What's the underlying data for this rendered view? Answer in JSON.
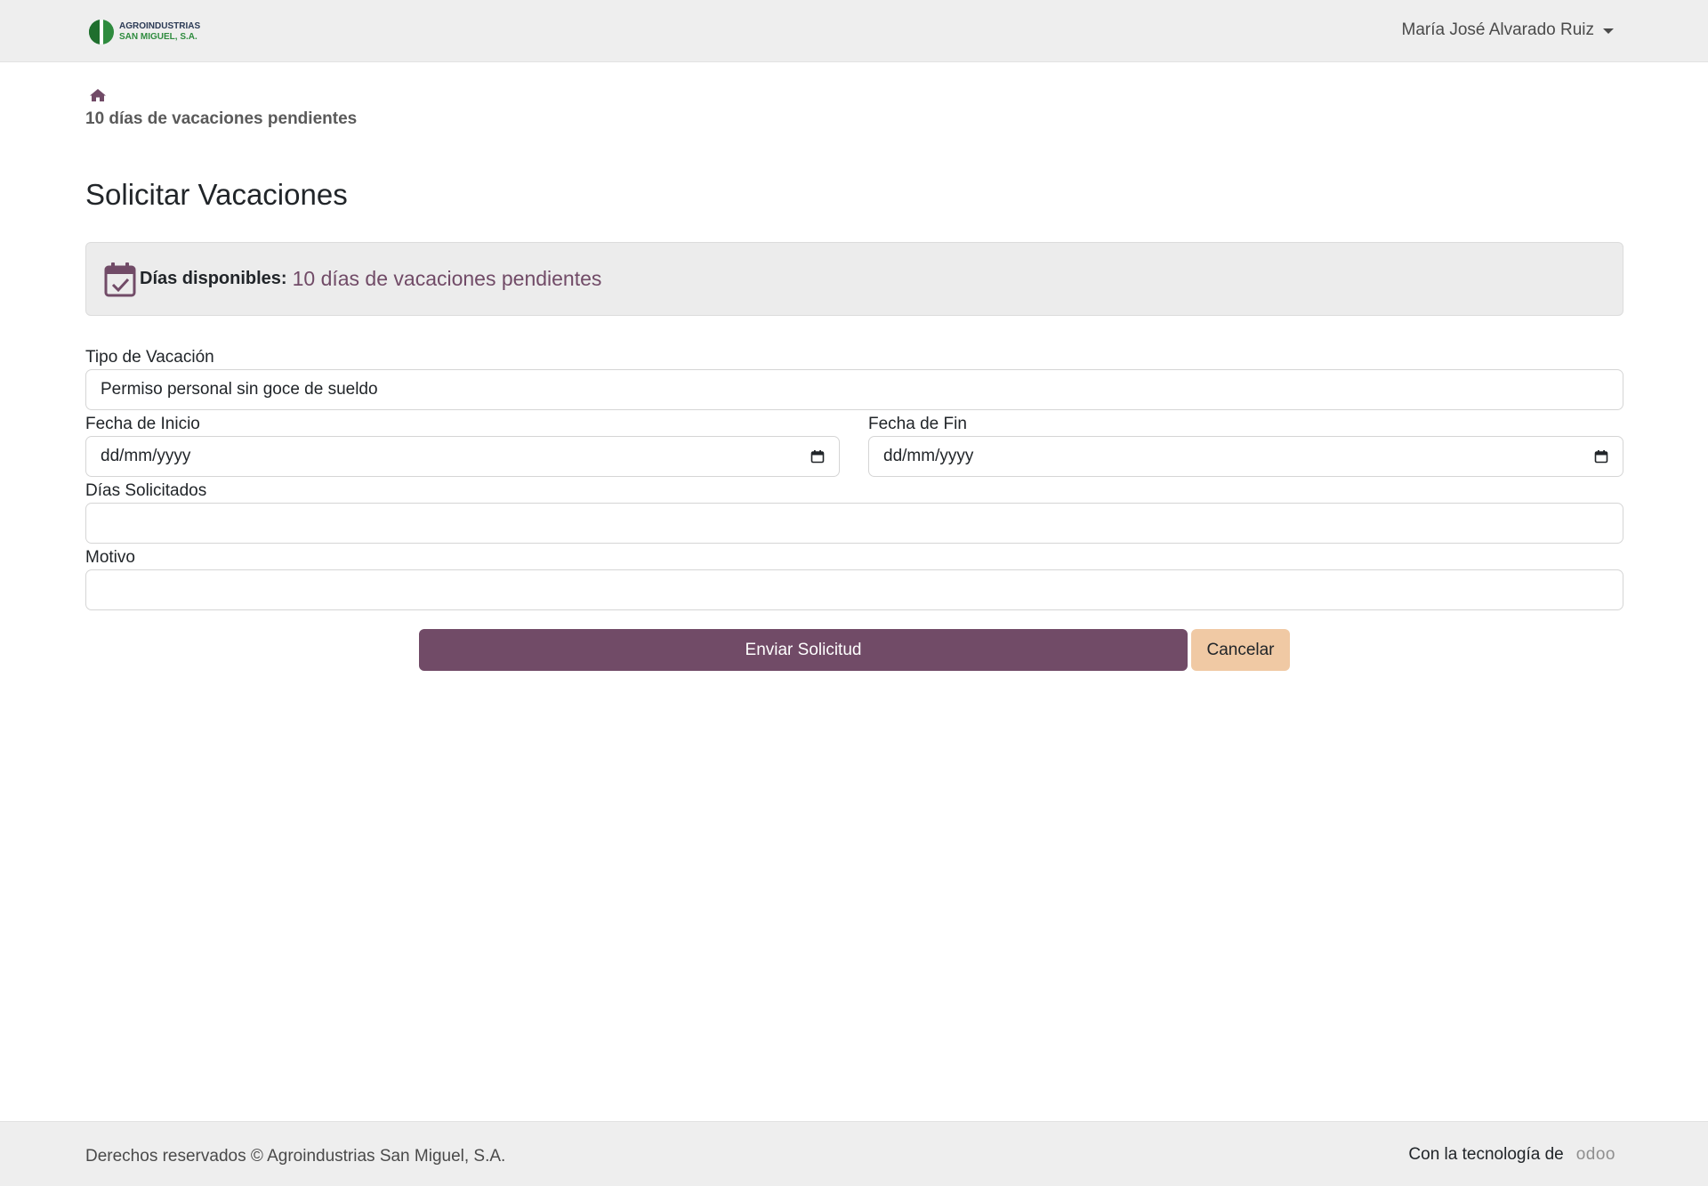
{
  "header": {
    "logo_line1": "AGROINDUSTRIAS",
    "logo_line2": "SAN MIGUEL, S.A.",
    "user_name": "María José Alvarado Ruiz"
  },
  "breadcrumb": {
    "home_icon": "home-icon",
    "pending_text": "10 días de vacaciones pendientes"
  },
  "page": {
    "title": "Solicitar Vacaciones"
  },
  "info": {
    "icon": "calendar-check-icon",
    "label": "Días disponibles:",
    "value": "10 días de vacaciones pendientes"
  },
  "form": {
    "tipo_label": "Tipo de Vacación",
    "tipo_value": "Permiso personal sin goce de sueldo",
    "fecha_inicio_label": "Fecha de Inicio",
    "fecha_inicio_value": "dd/mm/yyyy",
    "fecha_fin_label": "Fecha de Fin",
    "fecha_fin_value": "dd/mm/yyyy",
    "dias_label": "Días Solicitados",
    "dias_value": "",
    "motivo_label": "Motivo",
    "motivo_value": "",
    "submit_label": "Enviar Solicitud",
    "cancel_label": "Cancelar"
  },
  "footer": {
    "copyright": "Derechos reservados © Agroindustrias San Miguel, S.A.",
    "powered_by": "Con la tecnología de",
    "odoo_brand": "odoo"
  },
  "colors": {
    "primary": "#714b67",
    "cancel": "#f0c9a4",
    "header_bg": "#eeeeee",
    "brand_green": "#2e8b3e"
  }
}
